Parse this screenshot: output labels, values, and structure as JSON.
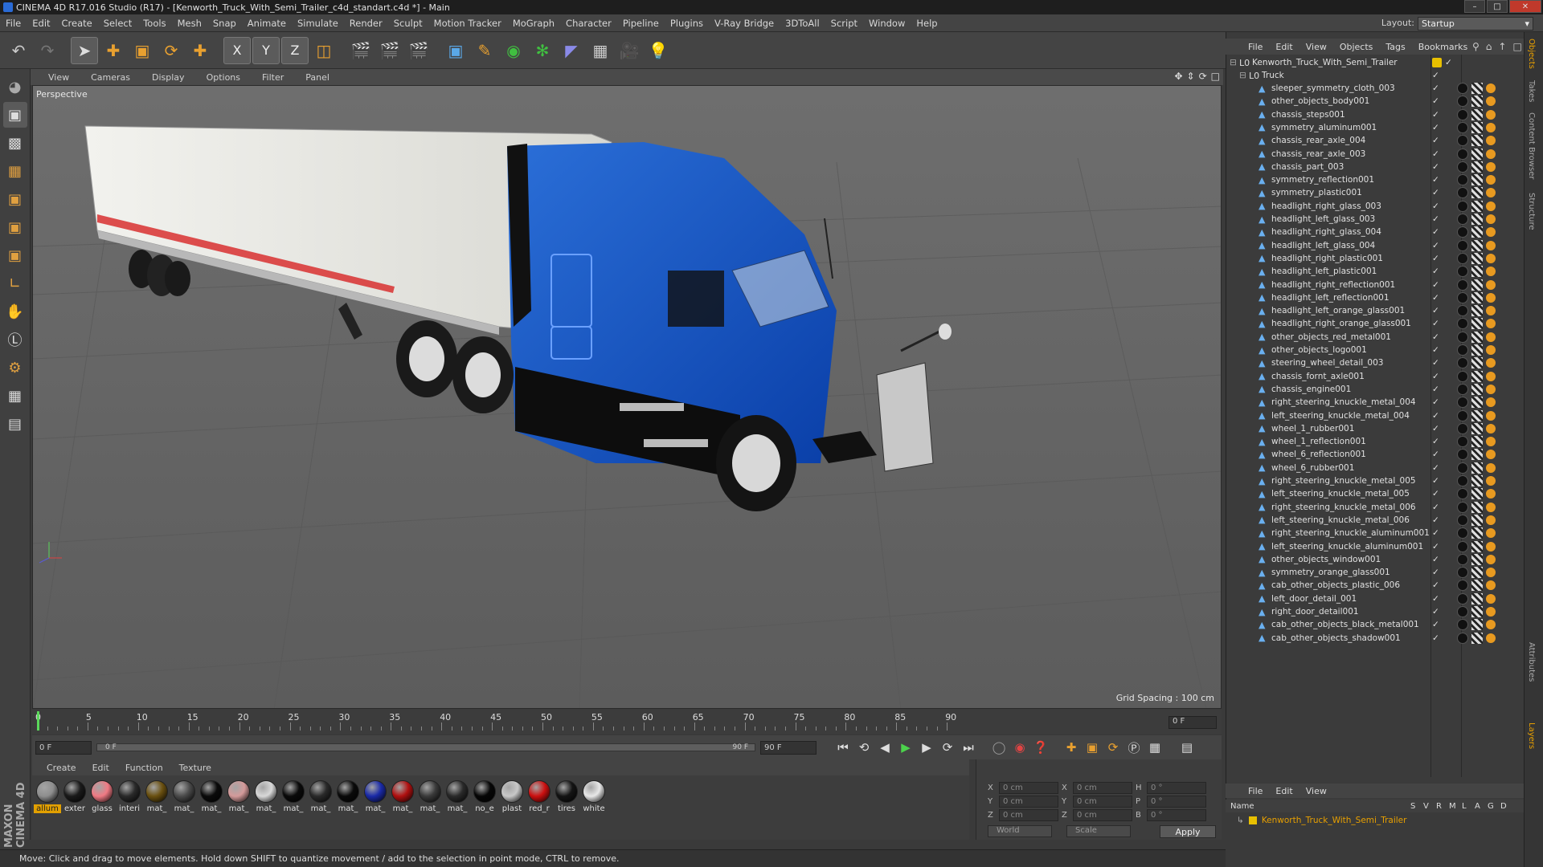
{
  "window": {
    "title": "CINEMA 4D R17.016 Studio (R17) - [Kenworth_Truck_With_Semi_Trailer_c4d_standart.c4d *] - Main",
    "controls": [
      "minimize",
      "maximize",
      "close"
    ]
  },
  "menubar": {
    "items": [
      "File",
      "Edit",
      "Create",
      "Select",
      "Tools",
      "Mesh",
      "Snap",
      "Animate",
      "Simulate",
      "Render",
      "Sculpt",
      "Motion Tracker",
      "MoGraph",
      "Character",
      "Pipeline",
      "Plugins",
      "V-Ray Bridge",
      "3DToAll",
      "Script",
      "Window",
      "Help"
    ],
    "layout_label": "Layout:",
    "layout_value": "Startup"
  },
  "toolbar": {
    "icons": [
      "undo-icon",
      "redo-icon",
      "live-selection-icon",
      "move-icon",
      "scale-icon",
      "rotate-icon",
      "transform-icon",
      "x-axis-icon",
      "y-axis-icon",
      "z-axis-icon",
      "coordinate-system-icon",
      "render-view-icon",
      "render-picture-viewer-icon",
      "render-settings-icon",
      "cube-icon",
      "spline-pen-icon",
      "nurbs-icon",
      "array-icon",
      "deformer-icon",
      "floor-icon",
      "camera-icon",
      "light-icon"
    ],
    "axis_labels": [
      "X",
      "Y",
      "Z"
    ]
  },
  "left_tools": [
    "make-editable-icon",
    "model-mode-icon",
    "texture-mode-icon",
    "workplane-icon",
    "points-mode-icon",
    "edges-mode-icon",
    "polygons-mode-icon",
    "axis-icon",
    "tweak-icon",
    "snap-icon",
    "magnet-icon",
    "grid-snap-icon",
    "solo-icon"
  ],
  "viewport": {
    "menus": [
      "View",
      "Cameras",
      "Display",
      "Options",
      "Filter",
      "Panel"
    ],
    "camera_label": "Perspective",
    "grid_spacing": "Grid Spacing : 100 cm"
  },
  "timeline": {
    "ticks": [
      "0",
      "5",
      "10",
      "15",
      "20",
      "25",
      "30",
      "35",
      "40",
      "45",
      "50",
      "55",
      "60",
      "65",
      "70",
      "75",
      "80",
      "85",
      "90"
    ],
    "frame_end_field": "0 F",
    "start_field": "0 F",
    "scrub_start": "0 F",
    "scrub_end": "90 F",
    "end_field": "90 F"
  },
  "materials": {
    "menus": [
      "Create",
      "Edit",
      "Function",
      "Texture"
    ],
    "items": [
      {
        "name": "allum",
        "color": "#8e8e8e"
      },
      {
        "name": "exter",
        "color": "#1a1a1a"
      },
      {
        "name": "glass",
        "color": "#f07a84"
      },
      {
        "name": "interi",
        "color": "#2a2a2a"
      },
      {
        "name": "mat_",
        "color": "#6a5010"
      },
      {
        "name": "mat_",
        "color": "#4a4a4a"
      },
      {
        "name": "mat_",
        "color": "#0a0a0a"
      },
      {
        "name": "mat_",
        "color": "#d49a9a"
      },
      {
        "name": "mat_",
        "color": "#d8d8d8"
      },
      {
        "name": "mat_",
        "color": "#0a0a0a"
      },
      {
        "name": "mat_",
        "color": "#2a2a2a"
      },
      {
        "name": "mat_",
        "color": "#0a0a0a"
      },
      {
        "name": "mat_",
        "color": "#1a2aa8"
      },
      {
        "name": "mat_",
        "color": "#b01010"
      },
      {
        "name": "mat_",
        "color": "#3a3a3a"
      },
      {
        "name": "mat_",
        "color": "#2a2a2a"
      },
      {
        "name": "no_e",
        "color": "#060606"
      },
      {
        "name": "plast",
        "color": "#c8c8c8"
      },
      {
        "name": "red_r",
        "color": "#cc1010"
      },
      {
        "name": "tires",
        "color": "#141414"
      },
      {
        "name": "white",
        "color": "#e8e8e8"
      }
    ]
  },
  "coordinates": {
    "rows": [
      {
        "a": "X",
        "av": "0 cm",
        "b": "X",
        "bv": "0 cm",
        "c": "H",
        "cv": "0 °"
      },
      {
        "a": "Y",
        "av": "0 cm",
        "b": "Y",
        "bv": "0 cm",
        "c": "P",
        "cv": "0 °"
      },
      {
        "a": "Z",
        "av": "0 cm",
        "b": "Z",
        "bv": "0 cm",
        "c": "B",
        "cv": "0 °"
      }
    ],
    "world": "World",
    "scale": "Scale",
    "apply": "Apply"
  },
  "status": "Move: Click and drag to move elements. Hold down SHIFT to quantize movement / add to the selection in point mode, CTRL to remove.",
  "maxon_logo": "MAXON CINEMA 4D",
  "object_manager": {
    "menus": [
      "File",
      "Edit",
      "View",
      "Objects",
      "Tags",
      "Bookmarks"
    ],
    "root": "Kenworth_Truck_With_Semi_Trailer",
    "group": "Truck",
    "objects": [
      "sleeper_symmetry_cloth_003",
      "other_objects_body001",
      "chassis_steps001",
      "symmetry_aluminum001",
      "chassis_rear_axle_004",
      "chassis_rear_axle_003",
      "chassis_part_003",
      "symmetry_reflection001",
      "symmetry_plastic001",
      "headlight_right_glass_003",
      "headlight_left_glass_003",
      "headlight_right_glass_004",
      "headlight_left_glass_004",
      "headlight_right_plastic001",
      "headlight_left_plastic001",
      "headlight_right_reflection001",
      "headlight_left_reflection001",
      "headlight_left_orange_glass001",
      "headlight_right_orange_glass001",
      "other_objects_red_metal001",
      "other_objects_logo001",
      "steering_wheel_detail_003",
      "chassis_fornt_axle001",
      "chassis_engine001",
      "right_steering_knuckle_metal_004",
      "left_steering_knuckle_metal_004",
      "wheel_1_rubber001",
      "wheel_1_reflection001",
      "wheel_6_reflection001",
      "wheel_6_rubber001",
      "right_steering_knuckle_metal_005",
      "left_steering_knuckle_metal_005",
      "right_steering_knuckle_metal_006",
      "left_steering_knuckle_metal_006",
      "right_steering_knuckle_aluminum001",
      "left_steering_knuckle_aluminum001",
      "other_objects_window001",
      "symmetry_orange_glass001",
      "cab_other_objects_plastic_006",
      "left_door_detail_001",
      "right_door_detail001",
      "cab_other_objects_black_metal001",
      "cab_other_objects_shadow001"
    ]
  },
  "layers": {
    "menus": [
      "File",
      "Edit",
      "View"
    ],
    "columns": [
      "Name",
      "S",
      "V",
      "R",
      "M",
      "L",
      "A",
      "G",
      "D"
    ],
    "row": "Kenworth_Truck_With_Semi_Trailer"
  },
  "right_tabs": [
    "Objects",
    "Takes",
    "Content Browser",
    "Structure",
    "Attributes",
    "Layers"
  ]
}
